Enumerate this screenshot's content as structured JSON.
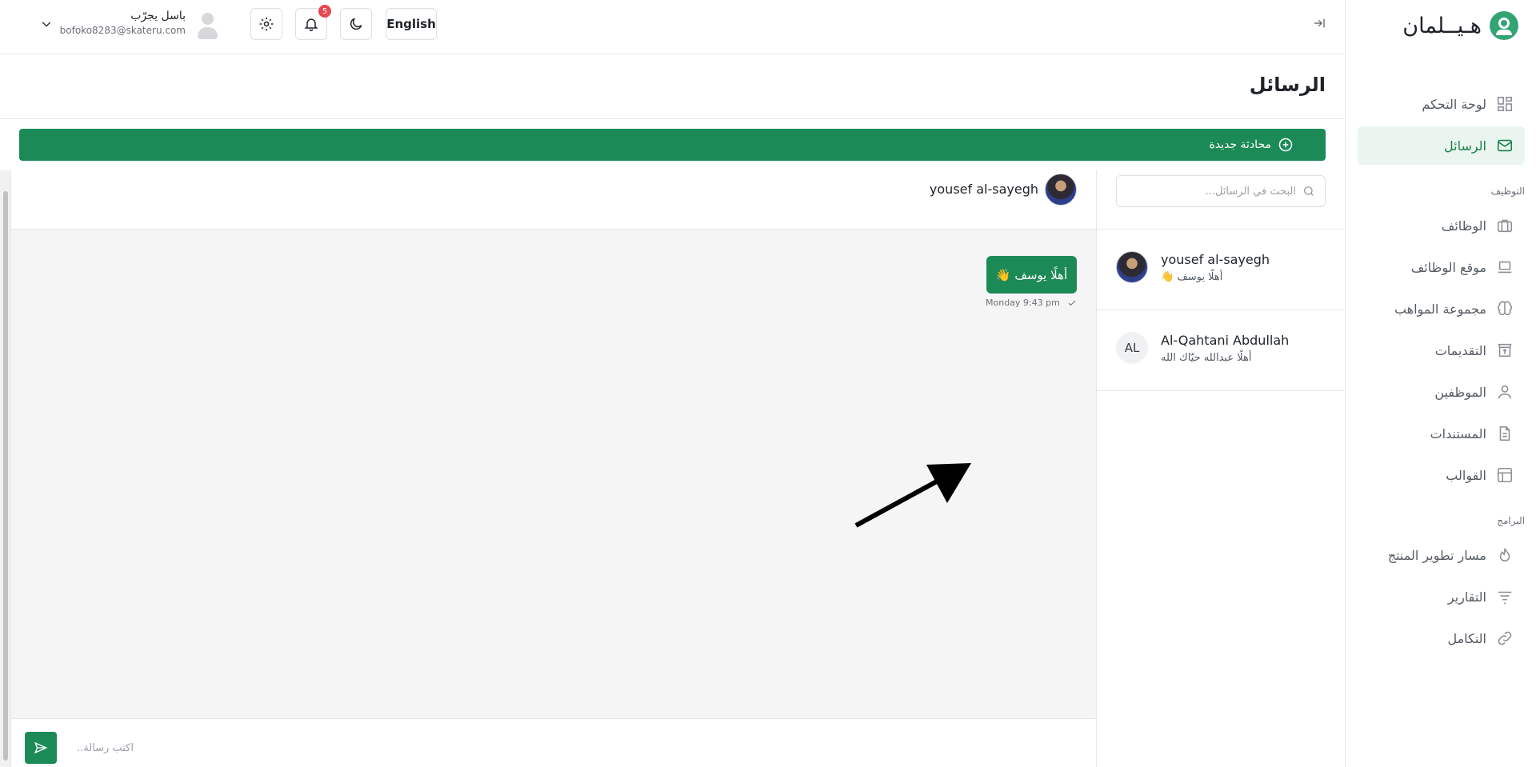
{
  "app": {
    "brand_name": "هـيــلمان",
    "accent_color": "#1c8a57"
  },
  "sidebar": {
    "items": [
      {
        "label": "لوحة التحكم",
        "icon": "dashboard-icon"
      },
      {
        "label": "الرسائل",
        "icon": "mail-icon",
        "active": true
      }
    ],
    "section_hiring": "التوظيف",
    "hiring_items": [
      {
        "label": "الوظائف",
        "icon": "briefcase-icon"
      },
      {
        "label": "موقع الوظائف",
        "icon": "laptop-icon"
      },
      {
        "label": "مجموعة المواهب",
        "icon": "brain-icon"
      },
      {
        "label": "التقديمات",
        "icon": "inbox-upload-icon"
      },
      {
        "label": "الموظفين",
        "icon": "user-icon"
      },
      {
        "label": "المستندات",
        "icon": "document-icon"
      },
      {
        "label": "القوالب",
        "icon": "template-icon"
      }
    ],
    "section_programs": "البرامج",
    "program_items": [
      {
        "label": "مسار تطوير المنتج",
        "icon": "flame-icon"
      },
      {
        "label": "التقارير",
        "icon": "filter-lines-icon"
      },
      {
        "label": "التكامل",
        "icon": "link-icon"
      }
    ]
  },
  "header": {
    "language_label": "English",
    "notification_count": "5",
    "user_name": "باسل يجرّب",
    "user_email": "bofoko8283@skateru.com"
  },
  "page": {
    "title": "الرسائل",
    "new_chat_label": "محادثة جديدة"
  },
  "chat_list": {
    "search_placeholder": "البحث في الرسائل...",
    "conversations": [
      {
        "name": "yousef al-sayegh",
        "preview": "أهلًا يوسف 👋",
        "avatar": "photo"
      },
      {
        "name": "Al-Qahtani Abdullah",
        "preview": "أهلًا عبدالله حيّاك الله",
        "avatar_initials": "AL"
      }
    ]
  },
  "conversation": {
    "contact_name": "yousef al-sayegh",
    "messages": [
      {
        "text": "أهلًا يوسف 👋",
        "time": "Monday 9:43 pm",
        "status": "sent"
      }
    ],
    "composer_placeholder": "اكتب رسالة.."
  }
}
